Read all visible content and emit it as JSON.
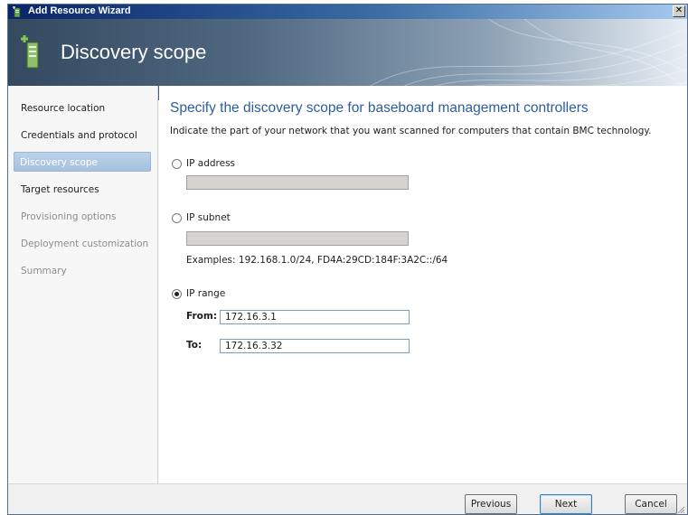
{
  "window": {
    "title": "Add Resource Wizard",
    "close_glyph": "✕"
  },
  "header": {
    "title": "Discovery scope",
    "icon": "server-add-icon"
  },
  "nav": {
    "items": [
      {
        "label": "Resource location",
        "state": "done"
      },
      {
        "label": "Credentials and protocol",
        "state": "done"
      },
      {
        "label": "Discovery scope",
        "state": "active"
      },
      {
        "label": "Target resources",
        "state": "pending"
      },
      {
        "label": "Provisioning options",
        "state": "pending"
      },
      {
        "label": "Deployment customization",
        "state": "pending"
      },
      {
        "label": "Summary",
        "state": "pending"
      }
    ]
  },
  "content": {
    "heading": "Specify the discovery scope for baseboard management controllers",
    "description": "Indicate the part of your network that you want scanned for computers that contain BMC technology.",
    "ip_address": {
      "label": "IP address",
      "selected": false,
      "value": ""
    },
    "ip_subnet": {
      "label": "IP subnet",
      "selected": false,
      "value": "",
      "examples": "Examples: 192.168.1.0/24, FD4A:29CD:184F:3A2C::/64"
    },
    "ip_range": {
      "label": "IP range",
      "selected": true,
      "from_label": "From:",
      "from_value": "172.16.3.1",
      "to_label": "To:",
      "to_value": "172.16.3.32"
    }
  },
  "footer": {
    "previous_label": "Previous",
    "next_label": "Next",
    "cancel_label": "Cancel"
  },
  "colors": {
    "accent": "#2e5d9b",
    "nav_active": "#a6c0de",
    "titlebar": "#0a246a"
  }
}
